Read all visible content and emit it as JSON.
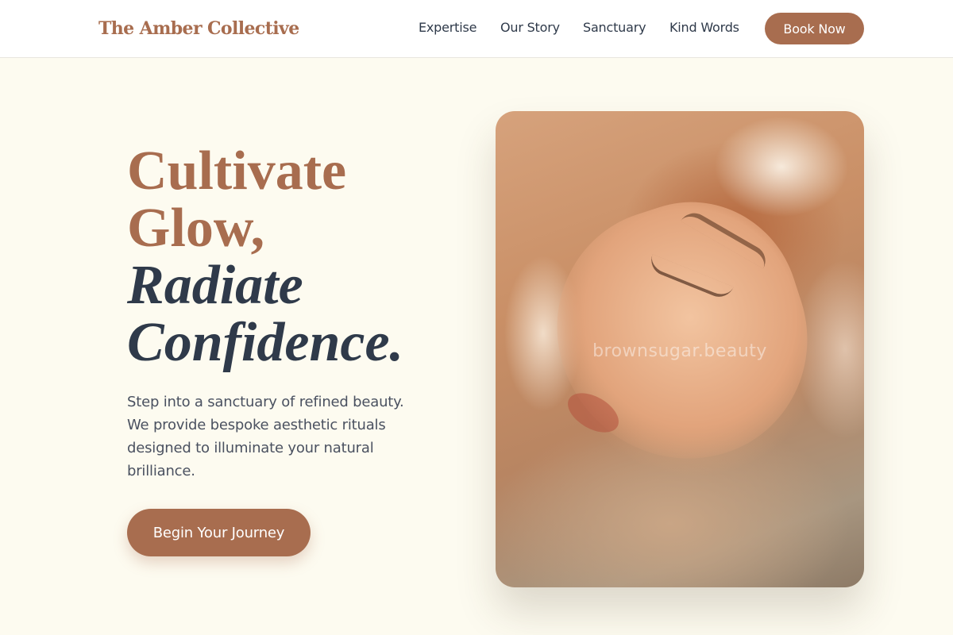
{
  "brand": {
    "name": "The Amber Collective"
  },
  "nav": {
    "links": [
      {
        "label": "Expertise"
      },
      {
        "label": "Our Story"
      },
      {
        "label": "Sanctuary"
      },
      {
        "label": "Kind Words"
      }
    ],
    "cta_label": "Book Now"
  },
  "hero": {
    "headline": {
      "line1": "Cultivate",
      "line2": "Glow,",
      "line3": "Radiate",
      "line4": "Confidence."
    },
    "intro": "Step into a sanctuary of refined beauty. We provide bespoke aesthetic rituals designed to illuminate your natural brilliance.",
    "cta_label": "Begin Your Journey",
    "image": {
      "watermark": "brownsugar.beauty",
      "alt": "Woman with eyes closed in warm amber light"
    }
  },
  "colors": {
    "accent": "#a86d4f",
    "text_dark": "#2f3a4a",
    "body_text": "#4a5160",
    "background": "#fdfbf0",
    "nav_background": "#ffffff"
  }
}
